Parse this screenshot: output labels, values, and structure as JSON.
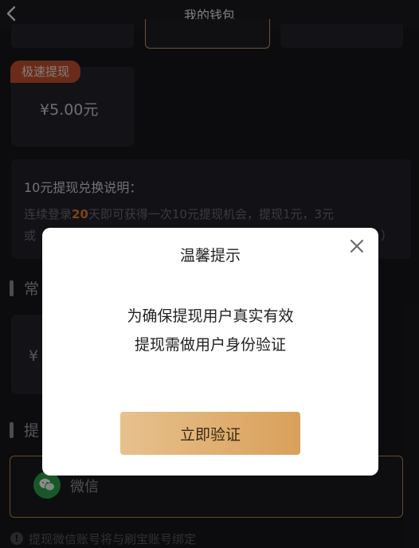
{
  "header": {
    "title": "我的钱包",
    "back_icon": "chevron-left-icon"
  },
  "cash_option": {
    "badge": "极速提现",
    "amount": "¥5.00元"
  },
  "info": {
    "title": "10元提现兑换说明：",
    "line1_prefix": "连续登录",
    "line1_highlight": "20",
    "line1_suffix": "天即可获得一次10元提现机会，提现1元，3元",
    "line2_start": "或",
    "line2_end": "）"
  },
  "section_common": {
    "label": "常"
  },
  "section_common_amount": "¥",
  "section_withdraw": {
    "label": "提"
  },
  "wechat": {
    "label": "微信",
    "icon": "wechat-icon"
  },
  "note": {
    "icon": "info-icon",
    "text": "提现微信账号将与刷宝账号绑定"
  },
  "modal": {
    "title": "温馨提示",
    "close_icon": "close-icon",
    "line1": "为确保提现用户真实有效",
    "line2": "提现需做用户身份验证",
    "button": "立即验证"
  },
  "colors": {
    "accent": "#d9a05a",
    "badge": "#c2502e",
    "highlight": "#e07a2a",
    "wechat": "#2da14a"
  }
}
